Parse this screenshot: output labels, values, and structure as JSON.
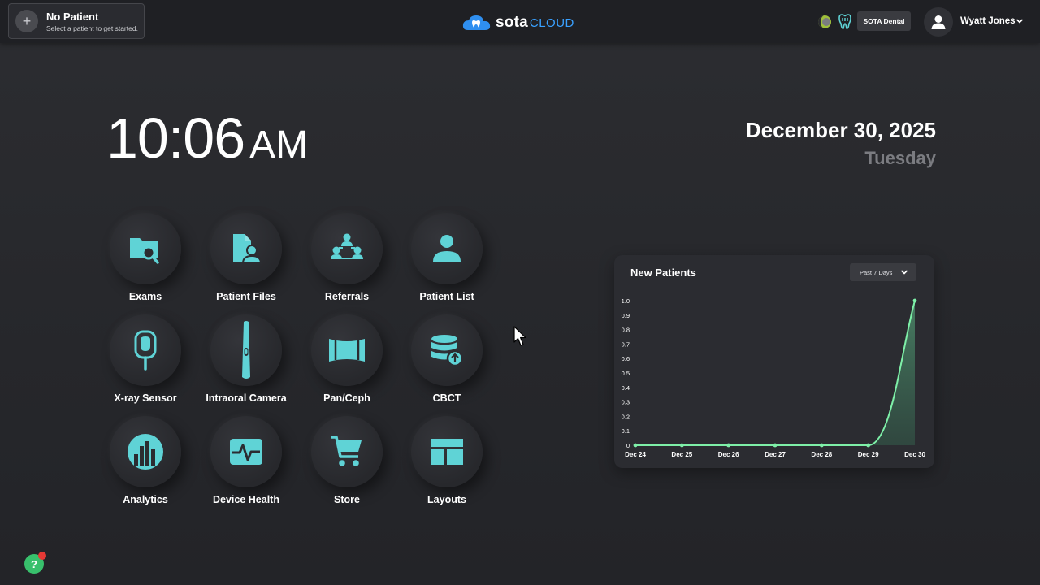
{
  "header": {
    "patient_title": "No Patient",
    "patient_subtitle": "Select a patient to get started.",
    "logo_sota": "sota",
    "logo_cloud": "CLOUD",
    "practice_name": "SOTA Dental",
    "user_name": "Wyatt Jones",
    "icons": [
      "plus-icon",
      "theme-toggle-icon",
      "tooth-icon",
      "user-avatar-icon",
      "chevron-down-icon"
    ]
  },
  "clock": {
    "time": "10:06",
    "ampm": "AM",
    "date": "December 30, 2025",
    "weekday": "Tuesday"
  },
  "apps": [
    {
      "label": "Exams",
      "icon": "folder-search-icon"
    },
    {
      "label": "Patient Files",
      "icon": "patient-file-icon"
    },
    {
      "label": "Referrals",
      "icon": "referrals-icon"
    },
    {
      "label": "Patient List",
      "icon": "person-icon"
    },
    {
      "label": "X-ray Sensor",
      "icon": "xray-sensor-icon"
    },
    {
      "label": "Intraoral Camera",
      "icon": "intraoral-camera-icon"
    },
    {
      "label": "Pan/Ceph",
      "icon": "pan-ceph-icon"
    },
    {
      "label": "CBCT",
      "icon": "cbct-database-icon"
    },
    {
      "label": "Analytics",
      "icon": "analytics-icon"
    },
    {
      "label": "Device Health",
      "icon": "device-health-icon"
    },
    {
      "label": "Store",
      "icon": "cart-icon"
    },
    {
      "label": "Layouts",
      "icon": "layouts-icon"
    }
  ],
  "colors": {
    "accent": "#5fd3d6",
    "chart_line": "#7ef0a8",
    "help": "#38c06c",
    "notification": "#e53935"
  },
  "chart_data": {
    "type": "area",
    "title": "New Patients",
    "range_label": "Past 7 Days",
    "categories": [
      "Dec 24",
      "Dec 25",
      "Dec 26",
      "Dec 27",
      "Dec 28",
      "Dec 29",
      "Dec 30"
    ],
    "values": [
      0,
      0,
      0,
      0,
      0,
      0,
      1.0
    ],
    "ylim": [
      0,
      1.0
    ],
    "yticks": [
      "0",
      "0.1",
      "0.2",
      "0.3",
      "0.4",
      "0.5",
      "0.6",
      "0.7",
      "0.8",
      "0.9",
      "1.0"
    ],
    "grid": false
  },
  "help": {
    "label": "?"
  }
}
